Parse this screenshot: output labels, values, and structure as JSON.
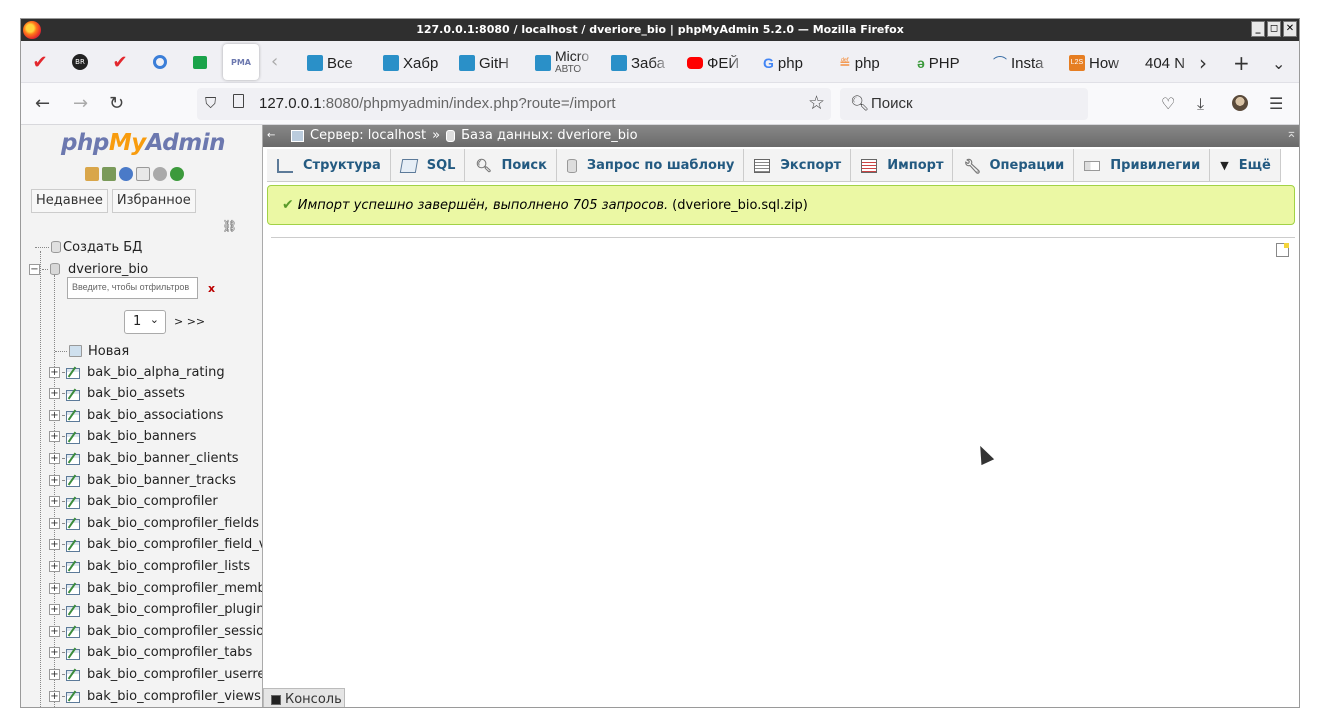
{
  "window": {
    "title": "127.0.0.1:8080 / localhost / dveriore_bio | phpMyAdmin 5.2.0 — Mozilla Firefox",
    "buttons": [
      "_",
      "◻",
      "✕"
    ]
  },
  "tabs": {
    "active_label": "PMA",
    "bookmarks": [
      {
        "label": "Все",
        "icon": "star-ext-icon",
        "color": "#2a90c8"
      },
      {
        "label": "Хабр",
        "icon": "star-ext-icon",
        "color": "#2a90c8"
      },
      {
        "label": "GitH",
        "icon": "star-ext-icon",
        "color": "#2a90c8"
      },
      {
        "label": "Micro",
        "sub": "АВТО",
        "icon": "star-ext-icon",
        "color": "#2a90c8"
      },
      {
        "label": "Заба",
        "icon": "star-ext-icon",
        "color": "#2a90c8"
      },
      {
        "label": "ФЕЙ",
        "icon": "youtube-icon",
        "color": "#ff0000"
      },
      {
        "label": "php",
        "icon": "google-icon",
        "color": "#4285f4"
      },
      {
        "label": "php",
        "icon": "stackoverflow-icon",
        "color": "#f48024"
      },
      {
        "label": "PHP",
        "icon": "php-icon",
        "color": "#3c9a3c"
      },
      {
        "label": "Insta",
        "icon": "insta-icon",
        "color": "#3a6ea5"
      },
      {
        "label": "How",
        "icon": "l2s-icon",
        "color": "#e67e22"
      },
      {
        "label": "404 N",
        "icon": "",
        "color": ""
      }
    ]
  },
  "nav": {
    "url_host": "127.0.0.1",
    "url_rest": ":8080/phpmyadmin/index.php?route=/import",
    "search_placeholder": "Поиск"
  },
  "sidebar": {
    "logo_php": "php",
    "logo_my": "My",
    "logo_admin": "Admin",
    "tab_recent": "Недавнее",
    "tab_favorites": "Избранное",
    "create_db": "Создать БД",
    "database": "dveriore_bio",
    "filter_placeholder": "Введите, чтобы отфильтров",
    "filter_clear": "x",
    "page_value": "1",
    "page_next": "> >>",
    "new_table": "Новая",
    "tables": [
      "bak_bio_alpha_rating",
      "bak_bio_assets",
      "bak_bio_associations",
      "bak_bio_banners",
      "bak_bio_banner_clients",
      "bak_bio_banner_tracks",
      "bak_bio_comprofiler",
      "bak_bio_comprofiler_fields",
      "bak_bio_comprofiler_field_val",
      "bak_bio_comprofiler_lists",
      "bak_bio_comprofiler_member",
      "bak_bio_comprofiler_plugin",
      "bak_bio_comprofiler_sessions",
      "bak_bio_comprofiler_tabs",
      "bak_bio_comprofiler_userrep",
      "bak_bio_comprofiler_views"
    ]
  },
  "breadcrumb": {
    "server": "Сервер: localhost",
    "sep": "»",
    "database": "База данных: dveriore_bio"
  },
  "menu": [
    {
      "label": "Структура",
      "icon": "structure-icon"
    },
    {
      "label": "SQL",
      "icon": "sql-icon"
    },
    {
      "label": "Поиск",
      "icon": "search-icon"
    },
    {
      "label": "Запрос по шаблону",
      "icon": "query-icon"
    },
    {
      "label": "Экспорт",
      "icon": "export-icon"
    },
    {
      "label": "Импорт",
      "icon": "import-icon"
    },
    {
      "label": "Операции",
      "icon": "wrench-icon"
    },
    {
      "label": "Привилегии",
      "icon": "privileges-icon"
    },
    {
      "label": "Ещё",
      "icon": "triangle-down-icon"
    }
  ],
  "message": {
    "italic": "Импорт успешно завершён, выполнено 705 запросов.",
    "file": "(dveriore_bio.sql.zip)"
  },
  "console": {
    "label": "Консоль"
  }
}
